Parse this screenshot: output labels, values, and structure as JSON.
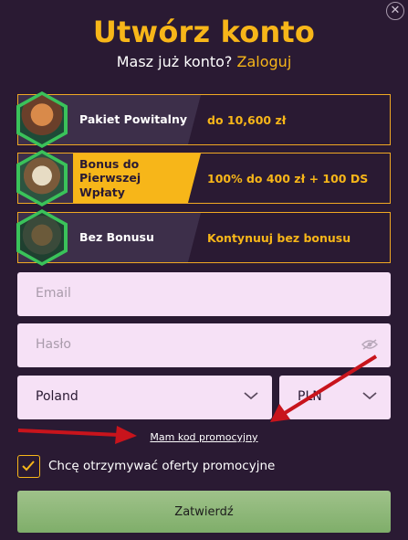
{
  "header": {
    "title": "Utwórz konto",
    "have_account": "Masz już konto?",
    "login_link": "Zaloguj",
    "close_symbol": "✕"
  },
  "bonuses": [
    {
      "name": "Pakiet Powitalny",
      "value": "do 10,600 zł",
      "selected": false,
      "icon": "monkey-king-avatar"
    },
    {
      "name": "Bonus do Pierwszej Wpłaty",
      "value": "100% do 400 zł + 100 DS",
      "selected": true,
      "icon": "pirate-captain-avatar"
    },
    {
      "name": "Bez Bonusu",
      "value": "Kontynuuj bez bonusu",
      "selected": false,
      "icon": "warrior-avatar"
    }
  ],
  "form": {
    "email_placeholder": "Email",
    "password_placeholder": "Hasło",
    "country": "Poland",
    "currency": "PLN",
    "promo_link": "Mam kod promocyjny",
    "offers_label": "Chcę otrzymywać oferty promocyjne",
    "offers_checked": true,
    "submit_label": "Zatwierdź"
  },
  "colors": {
    "background": "#2a1a33",
    "accent": "#f7b619",
    "field_bg": "#f6e1f6",
    "submit_bg": "#8fb87a",
    "annotation_arrow": "#c8141c"
  }
}
